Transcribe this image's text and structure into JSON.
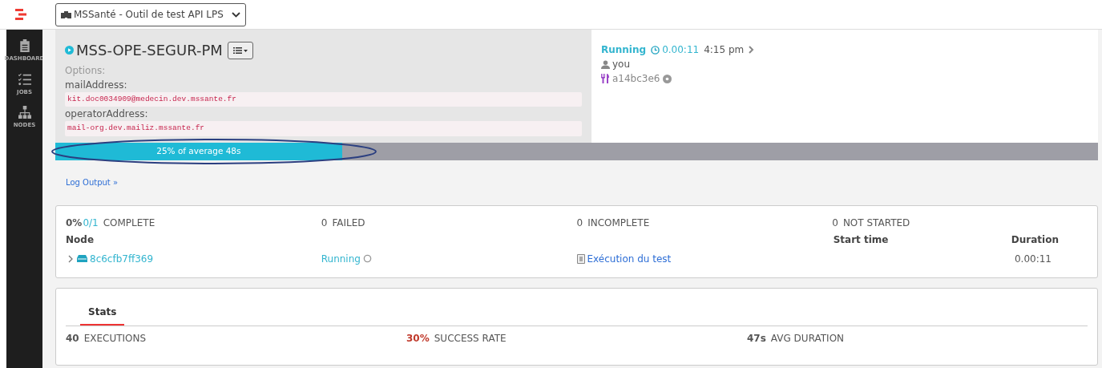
{
  "project_selector": {
    "label": "MSSanté - Outil de test API LPS"
  },
  "sidebar": {
    "items": [
      {
        "label": "DASHBOARD",
        "kind": "clipboard"
      },
      {
        "label": "JOBS",
        "kind": "checklist"
      },
      {
        "label": "NODES",
        "kind": "hierarchy"
      }
    ]
  },
  "job": {
    "name": "MSS-OPE-SEGUR-PM",
    "options_label": "Options:",
    "options": [
      {
        "name": "mailAddress:",
        "value": "kit.doc0034909@medecin.dev.mssante.fr"
      },
      {
        "name": "operatorAddress:",
        "value": "mail-org.dev.mailiz.mssante.fr"
      }
    ],
    "status": "Running",
    "elapsed": "0.00:11",
    "started": "4:15 pm",
    "user": "you",
    "execution_id": "a14bc3e6"
  },
  "progress": {
    "level": 0.275,
    "label": "25% of average 48s",
    "annotation": {
      "kind": "ellipse"
    }
  },
  "log_link": "Log Output »",
  "summary": {
    "percent": "0%",
    "fraction": "0/1",
    "complete_label": "COMPLETE",
    "failed": "0",
    "failed_label": "FAILED",
    "incomplete": "0",
    "incomplete_label": "INCOMPLETE",
    "not_started": "0",
    "not_started_label": "NOT STARTED"
  },
  "table": {
    "columns": [
      "Node",
      "Start time",
      "Duration"
    ],
    "rows": [
      {
        "node": "8c6cfb7ff369",
        "expanded": false,
        "state": "Running",
        "step": "Exécution du test",
        "duration": "0.00:11"
      }
    ]
  },
  "stats": {
    "tabs": [
      {
        "label": "Stats",
        "selected": true
      }
    ],
    "items": [
      {
        "value": "40",
        "label": "EXECUTIONS",
        "kind": "plain"
      },
      {
        "value": "30%",
        "label": "SUCCESS RATE",
        "kind": "alert"
      },
      {
        "value": "47s",
        "label": "AVG DURATION",
        "kind": "plain"
      }
    ]
  }
}
